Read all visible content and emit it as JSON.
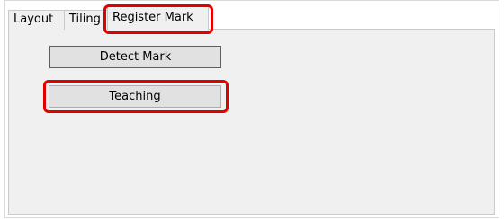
{
  "tabs": [
    {
      "label": "Layout"
    },
    {
      "label": "Tiling"
    },
    {
      "label": "Register Mark",
      "active": true
    }
  ],
  "buttons": {
    "detect_mark": "Detect Mark",
    "teaching": "Teaching"
  },
  "colors": {
    "highlight": "#e00000",
    "focus_border": "#0078d7",
    "panel_bg": "#f0f0f0"
  }
}
